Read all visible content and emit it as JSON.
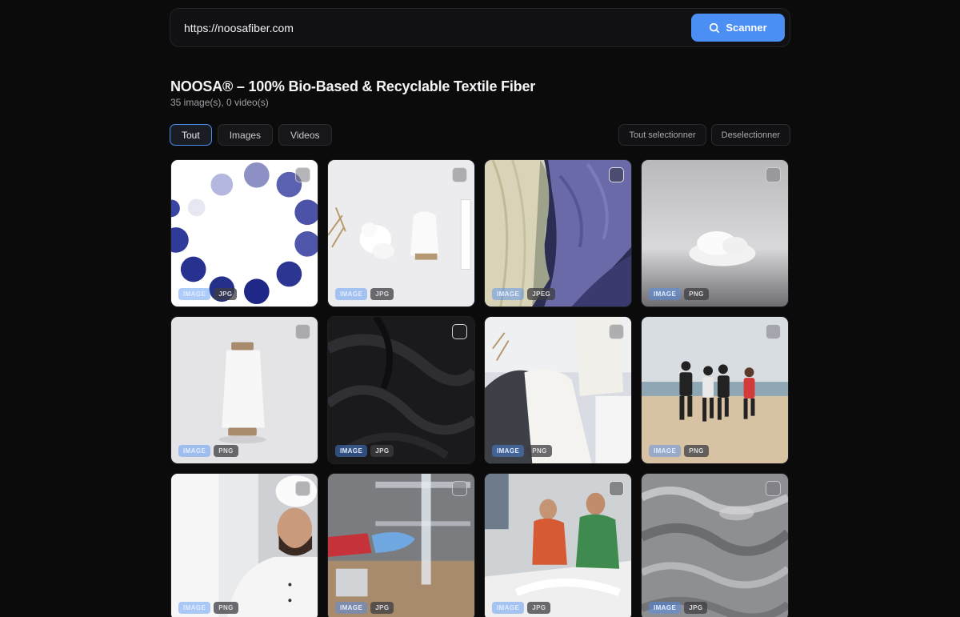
{
  "search": {
    "value": "https://noosafiber.com",
    "button_label": "Scanner"
  },
  "header": {
    "title": "NOOSA® – 100% Bio-Based & Recyclable Textile Fiber",
    "subtitle": "35 image(s), 0 video(s)"
  },
  "filters": [
    "Tout",
    "Images",
    "Videos"
  ],
  "active_filter": "Tout",
  "actions": {
    "select_all": "Tout selectionner",
    "deselect": "Deselectionner"
  },
  "accent_color": "#4b8ff4",
  "items": [
    {
      "type": "IMAGE",
      "format": "JPG",
      "icon": "dots-circle-image"
    },
    {
      "type": "IMAGE",
      "format": "JPG",
      "icon": "fiber-spool-image"
    },
    {
      "type": "IMAGE",
      "format": "JPEG",
      "icon": "yarn-skeins-image"
    },
    {
      "type": "IMAGE",
      "format": "PNG",
      "icon": "fiber-cloud-image"
    },
    {
      "type": "IMAGE",
      "format": "PNG",
      "icon": "white-spool-image"
    },
    {
      "type": "IMAGE",
      "format": "JPG",
      "icon": "black-fabric-image"
    },
    {
      "type": "IMAGE",
      "format": "PNG",
      "icon": "white-garment-image"
    },
    {
      "type": "IMAGE",
      "format": "PNG",
      "icon": "beach-runners-image"
    },
    {
      "type": "IMAGE",
      "format": "PNG",
      "icon": "chef-image"
    },
    {
      "type": "IMAGE",
      "format": "JPG",
      "icon": "lab-film-image"
    },
    {
      "type": "IMAGE",
      "format": "JPG",
      "icon": "textile-workers-image"
    },
    {
      "type": "IMAGE",
      "format": "JPG",
      "icon": "water-texture-image"
    }
  ]
}
